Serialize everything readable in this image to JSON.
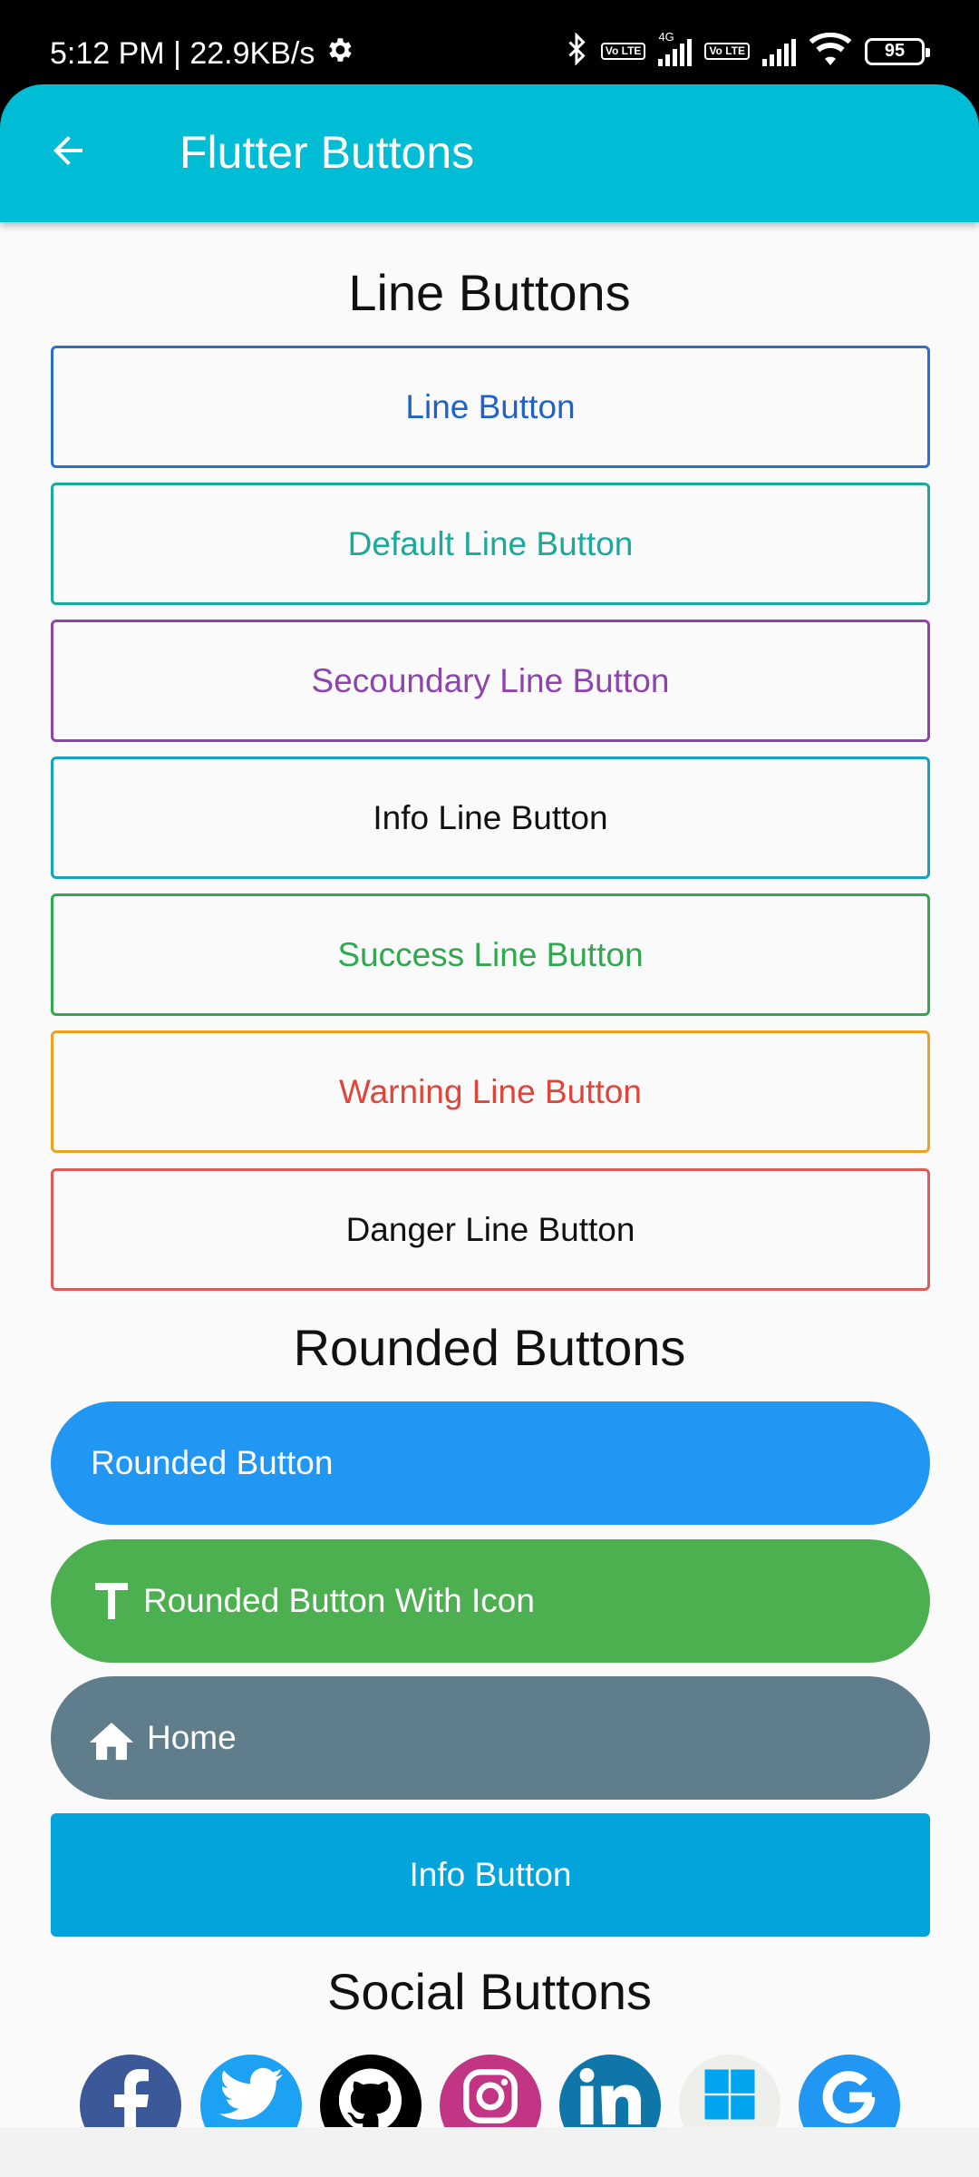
{
  "status_bar": {
    "time_speed": "5:12 PM | 22.9KB/s",
    "volte1": "Vo LTE",
    "network": "4G",
    "volte2": "Vo LTE",
    "battery": "95"
  },
  "app_bar": {
    "title": "Flutter Buttons"
  },
  "line_section": {
    "title": "Line Buttons",
    "buttons": [
      {
        "label": "Line Button",
        "color": "#1e63c8",
        "border": "#2a6fd0"
      },
      {
        "label": "Default Line Button",
        "color": "#1aaa9a",
        "border": "#1aaa9a"
      },
      {
        "label": "Secoundary Line Button",
        "color": "#8e44ad",
        "border": "#8e44ad"
      },
      {
        "label": "Info Line Button",
        "color": "#111111",
        "border": "#16a3c2"
      },
      {
        "label": "Success Line Button",
        "color": "#2fa84f",
        "border": "#2fa84f"
      },
      {
        "label": "Warning Line Button",
        "color": "#e0453a",
        "border": "#f0a020"
      },
      {
        "label": "Danger Line Button",
        "color": "#111111",
        "border": "#e05a5a"
      }
    ]
  },
  "rounded_section": {
    "title": "Rounded Buttons",
    "buttons": [
      {
        "label": "Rounded Button",
        "color": "#2196f3",
        "icon": "none"
      },
      {
        "label": "Rounded Button With Icon",
        "color": "#4caf50",
        "icon": "text-t-icon"
      },
      {
        "label": "Home",
        "color": "#607d8b",
        "icon": "home-icon"
      }
    ],
    "info_button": {
      "label": "Info Button",
      "color": "#03a3dc"
    }
  },
  "social_section": {
    "title": "Social Buttons",
    "buttons": [
      {
        "icon": "facebook-icon",
        "color": "#3b5998"
      },
      {
        "icon": "twitter-icon",
        "color": "#1da1f2"
      },
      {
        "icon": "github-icon",
        "color": "#000000"
      },
      {
        "icon": "instagram-icon",
        "color": "#c13584"
      },
      {
        "icon": "linkedin-icon",
        "color": "#0e76a8"
      },
      {
        "icon": "windows-icon",
        "color": "#eeeeea"
      },
      {
        "icon": "google-icon",
        "color": "#2196f3"
      }
    ]
  }
}
